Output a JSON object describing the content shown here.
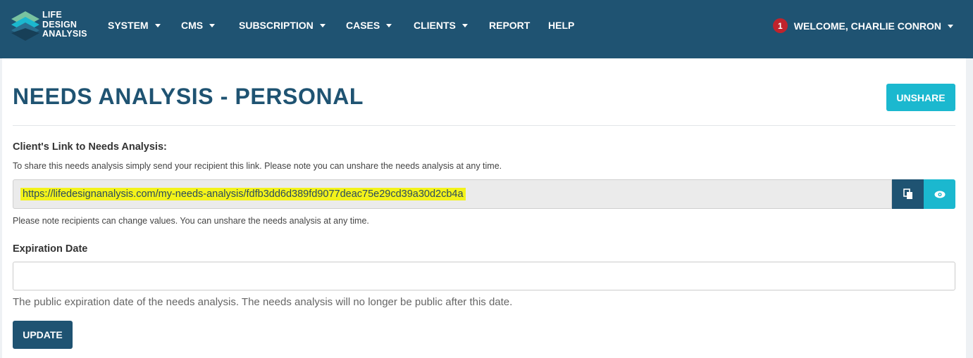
{
  "brand": {
    "line1": "LIFE",
    "line2": "DESIGN",
    "line3": "ANALYSIS"
  },
  "nav": [
    {
      "label": "SYSTEM",
      "dropdown": true
    },
    {
      "label": "CMS",
      "dropdown": true
    },
    {
      "label": "SUBSCRIPTION",
      "dropdown": true
    },
    {
      "label": "CASES",
      "dropdown": true
    },
    {
      "label": "CLIENTS",
      "dropdown": true
    },
    {
      "label": "REPORT",
      "dropdown": false
    },
    {
      "label": "HELP",
      "dropdown": false
    }
  ],
  "user": {
    "notification_count": "1",
    "welcome": "WELCOME, CHARLIE CONRON"
  },
  "page": {
    "title": "NEEDS ANALYSIS - PERSONAL",
    "unshare_label": "UNSHARE",
    "link_label": "Client's Link to Needs Analysis:",
    "link_help": "To share this needs analysis simply send your recipient this link. Please note you can unshare the needs analysis at any time.",
    "link_url": "https://lifedesignanalysis.com/my-needs-analysis/fdfb3dd6d389fd9077deac75e29cd39a30d2cb4a",
    "link_note": "Please note recipients can change values. You can unshare the needs analysis at any time.",
    "expiration_label": "Expiration Date",
    "expiration_value": "",
    "expiration_help": "The public expiration date of the needs analysis. The needs analysis will no longer be public after this date.",
    "update_label": "UPDATE"
  },
  "icons": {
    "copy": "copy-icon",
    "view": "eye-icon",
    "caret": "caret-down-icon"
  },
  "colors": {
    "navbar": "#1f5372",
    "accent": "#1bb8cf",
    "badge": "#c0232c",
    "highlight": "#f3f31a"
  }
}
